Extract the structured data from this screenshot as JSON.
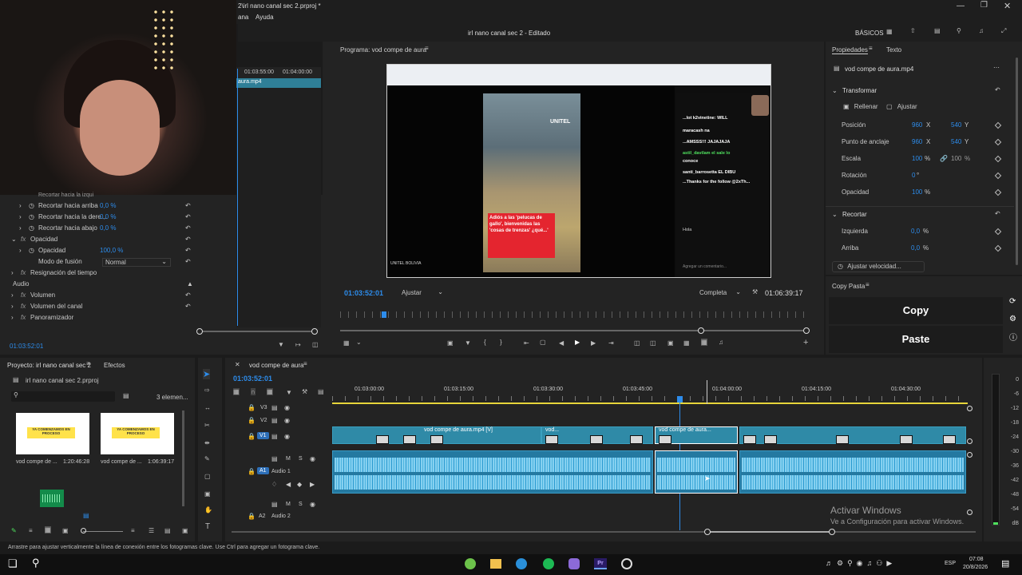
{
  "window": {
    "title_partial": "2\\irl nano canal sec 2.prproj *",
    "menu": [
      "ana",
      "Ayuda"
    ],
    "project_status": "irl nano canal sec 2 - Editado",
    "workspace": "BÁSICOS"
  },
  "effects_controls": {
    "ruler": [
      "01:03:55:00",
      "01:04:00:00"
    ],
    "clip_label": "aura.mp4",
    "rows": [
      {
        "label": "Recortar hacia arriba",
        "value": "0,0 %"
      },
      {
        "label": "Recortar hacia la dere...",
        "value": "0,0 %"
      },
      {
        "label": "Recortar hacia abajo",
        "value": "0,0 %"
      }
    ],
    "opacity_section": "Opacidad",
    "opacity_label": "Opacidad",
    "opacity_value": "100,0 %",
    "blend_label": "Modo de fusión",
    "blend_value": "Normal",
    "time_remap": "Resignación del tiempo",
    "audio_header": "Audio",
    "audio_rows": [
      "Volumen",
      "Volumen del canal",
      "Panoramizador"
    ],
    "timecode": "01:03:52:01"
  },
  "program_monitor": {
    "title": "Programa: vod compe de aura",
    "timecode": "01:03:52:01",
    "fit": "Ajustar",
    "resolution": "Completa",
    "duration": "01:06:39:17",
    "video_overlay": {
      "unitel": "UNITEL",
      "red_caption": "Adiós a las 'pelucas de gallo', bienvenidas las 'cosas de trenzas' ¿qué...'",
      "bottom_line": "UNITEL BOLIVIA",
      "chat_lines": [
        "...lot k2vinetine: WILL",
        "maracash na",
        "...AMSSS!!! JAJAJAJA",
        "astil_davilam el sale lo",
        "conoce",
        "santi_barrosetta EL DIBU",
        "...Thanks for the follow @2xTh...",
        "Hola",
        "Agregar un comentario..."
      ]
    }
  },
  "properties": {
    "tabs": [
      "Propiedades",
      "Texto"
    ],
    "file": "vod compe de aura.mp4",
    "transform_title": "Transformar",
    "fill": "Rellenar",
    "fit": "Ajustar",
    "rows": [
      {
        "label": "Posición",
        "x": "960",
        "xu": "X",
        "y": "540",
        "yu": "Y"
      },
      {
        "label": "Punto de anclaje",
        "x": "960",
        "xu": "X",
        "y": "540",
        "yu": "Y"
      },
      {
        "label": "Escala",
        "x": "100",
        "xu": "%",
        "y": "100",
        "yu": "%"
      },
      {
        "label": "Rotación",
        "x": "0",
        "xu": "°"
      },
      {
        "label": "Opacidad",
        "x": "100",
        "xu": "%"
      }
    ],
    "crop_title": "Recortar",
    "crop_rows": [
      {
        "label": "Izquierda",
        "v": "0,0",
        "u": "%"
      },
      {
        "label": "Arriba",
        "v": "0,0",
        "u": "%"
      }
    ],
    "speed_button": "Ajustar velocidad..."
  },
  "copy_paste": {
    "title": "Copy Pasta",
    "copy": "Copy",
    "paste": "Paste"
  },
  "project": {
    "tab": "Proyecto: irl nano canal sec 2",
    "effects_tab": "Efectos",
    "file": "irl nano canal sec 2.prproj",
    "count": "3 elemen...",
    "items": [
      {
        "name": "vod compe de ...",
        "duration": "1:20:46:28",
        "caption": "YA COMENZAMOS EN PROCESO"
      },
      {
        "name": "vod compe de ...",
        "duration": "1:06:39:17",
        "caption": "YA COMENZAMOS EN PROCESO"
      }
    ]
  },
  "timeline": {
    "sequence": "vod compe de aura",
    "timecode": "01:03:52:01",
    "ruler": [
      "01:03:00:00",
      "01:03:15:00",
      "01:03:30:00",
      "01:03:45:00",
      "01:04:00:00",
      "01:04:15:00",
      "01:04:30:00"
    ],
    "tracks": {
      "v3": "V3",
      "v2": "V2",
      "v1": "V1",
      "a1": "A1",
      "a1_name": "Audio 1",
      "a2": "A2",
      "a2_name": "Audio 2",
      "m": "M",
      "s": "S"
    },
    "clips": [
      {
        "label": "vod compe de aura.mp4 [V]"
      },
      {
        "label": "vod..."
      },
      {
        "label": "vod compe de aura..."
      }
    ]
  },
  "meter": [
    "0",
    "-6",
    "-12",
    "-18",
    "-24",
    "-30",
    "-36",
    "-42",
    "-48",
    "-54",
    "dB"
  ],
  "status_bar": "Arrastre para ajustar verticalmente la línea de conexión entre los fotogramas clave. Use Ctrl para agregar un fotograma clave.",
  "watermark": {
    "title": "Activar Windows",
    "sub": "Ve a Configuración para activar Windows."
  },
  "taskbar": {
    "lang": "ESP",
    "time": "07:08",
    "date": "20/8/2026"
  },
  "colors": {
    "accent_blue": "#2d8ceb",
    "clip_teal": "#2f8aa7",
    "audio_wave": "#6cc6ee"
  }
}
